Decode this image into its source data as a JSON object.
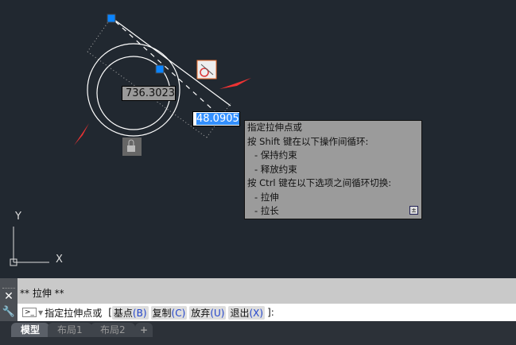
{
  "drawing": {
    "dim_length": "736.3023",
    "dim_input": "48.0905",
    "ucs_x": "X",
    "ucs_y": "Y"
  },
  "tooltip": {
    "lines": [
      "指定拉伸点或",
      "按 Shift 键在以下操作间循环:",
      "- 保持约束",
      "- 释放约束",
      "按 Ctrl 键在以下选项之间循环切换:",
      "- 拉伸",
      "- 拉长"
    ]
  },
  "command": {
    "history": "**  拉伸  **",
    "prompt": "指定拉伸点或",
    "bracket_open": "[",
    "bracket_close": "]:",
    "options": [
      {
        "label": "基点",
        "key": "(B)"
      },
      {
        "label": "复制",
        "key": "(C)"
      },
      {
        "label": "放弃",
        "key": "(U)"
      },
      {
        "label": "退出",
        "key": "(X)"
      }
    ]
  },
  "tabs": [
    "模型",
    "布局1",
    "布局2",
    "+"
  ],
  "colors": {
    "grip": "#0a84ff",
    "arrow": "#ee3333",
    "bg": "#212830"
  }
}
